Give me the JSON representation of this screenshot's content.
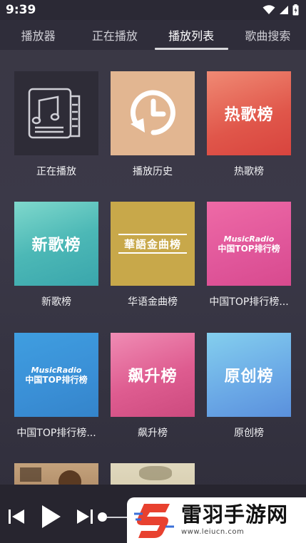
{
  "status_bar": {
    "time": "9:39"
  },
  "tabs": [
    {
      "label": "播放器"
    },
    {
      "label": "正在播放"
    },
    {
      "label": "播放列表",
      "active": true
    },
    {
      "label": "歌曲搜索"
    }
  ],
  "cards": [
    {
      "title": "正在播放",
      "cover_text": "",
      "icon": "music-document-icon"
    },
    {
      "title": "播放历史",
      "cover_text": "",
      "icon": "history-clock-icon"
    },
    {
      "title": "热歌榜",
      "cover_text": "热歌榜"
    },
    {
      "title": "新歌榜",
      "cover_text": "新歌榜"
    },
    {
      "title": "华语金曲榜",
      "cover_text": "華語金曲榜"
    },
    {
      "title": "中国TOP排行榜...",
      "cover_top": "MusicRadio",
      "cover_bottom": "中国TOP排行榜"
    },
    {
      "title": "中国TOP排行榜...",
      "cover_top": "MusicRadio",
      "cover_bottom": "中国TOP排行榜"
    },
    {
      "title": "飙升榜",
      "cover_text": "飙升榜"
    },
    {
      "title": "原创榜",
      "cover_text": "原创榜"
    }
  ],
  "colors": {
    "tab_bar": "#2f2d3a",
    "background": "#3a3744",
    "hot": "#e05a4e",
    "new": "#4ab8b4",
    "gold": "#c9a94a",
    "pink_radio": "#e0559a",
    "blue_radio": "#3a8fd6",
    "surge": "#d95a8c",
    "original": "#6aa8e6"
  },
  "player": {
    "prev_icon": "skip-previous-icon",
    "play_icon": "play-icon",
    "next_icon": "skip-next-icon"
  },
  "watermark": {
    "title": "雷羽手游网",
    "url": "www.leiucn.com"
  }
}
